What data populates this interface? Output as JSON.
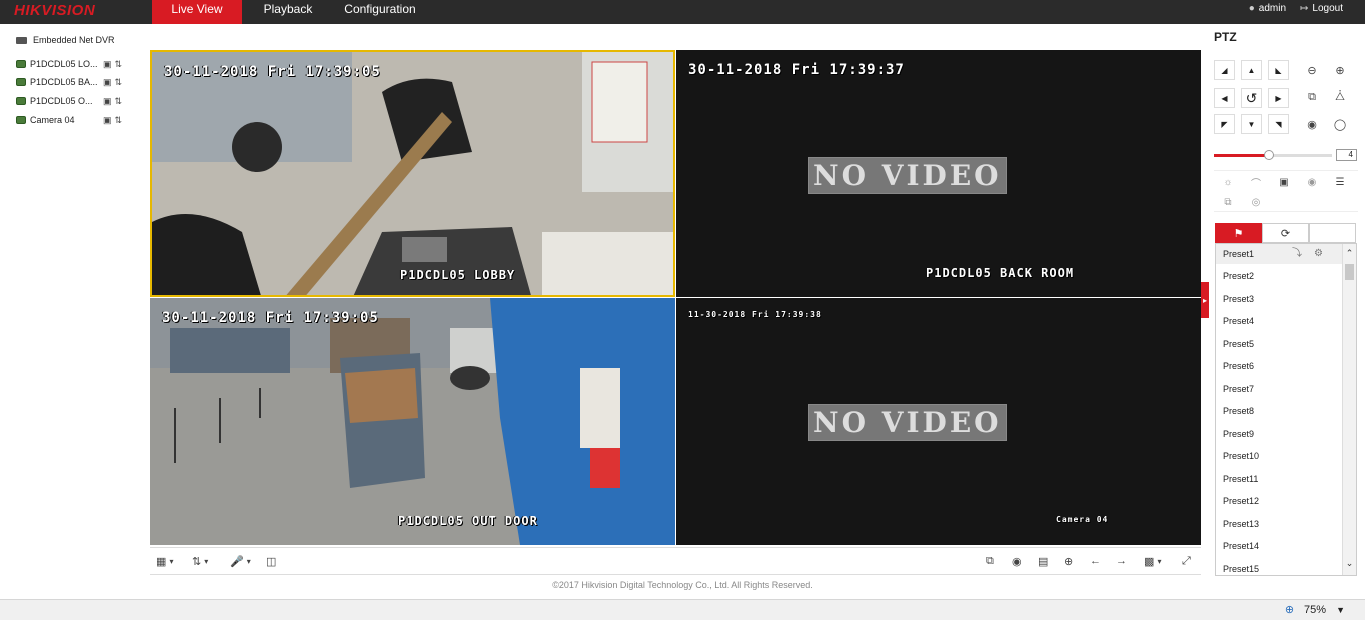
{
  "header": {
    "logo": "HIKVISION",
    "tabs": [
      {
        "label": "Live View",
        "active": true
      },
      {
        "label": "Playback"
      },
      {
        "label": "Configuration"
      }
    ],
    "user": "admin",
    "logout": "Logout"
  },
  "tree": {
    "root": "Embedded Net DVR",
    "cameras": [
      {
        "label": "P1DCDL05 LO..."
      },
      {
        "label": "P1DCDL05 BA..."
      },
      {
        "label": "P1DCDL05 O..."
      },
      {
        "label": "Camera 04"
      }
    ]
  },
  "video": {
    "panes": [
      {
        "timestamp": "30-11-2018 Fri 17:39:05",
        "name": "P1DCDL05 LOBBY",
        "selected": true
      },
      {
        "timestamp": "30-11-2018 Fri 17:39:37",
        "name": "P1DCDL05 BACK ROOM",
        "no_video": "NO VIDEO"
      },
      {
        "timestamp": "30-11-2018 Fri 17:39:05",
        "name": "P1DCDL05 OUT DOOR"
      },
      {
        "timestamp": "11-30-2018 Fri 17:39:38",
        "name": "Camera 04",
        "no_video": "NO VIDEO"
      }
    ]
  },
  "footer": {
    "copyright": "©2017 Hikvision Digital Technology Co., Ltd. All Rights Reserved."
  },
  "ptz": {
    "title": "PTZ",
    "speed": "4",
    "speed_fraction": 0.47,
    "presets": [
      "Preset1",
      "Preset2",
      "Preset3",
      "Preset4",
      "Preset5",
      "Preset6",
      "Preset7",
      "Preset8",
      "Preset9",
      "Preset10",
      "Preset11",
      "Preset12",
      "Preset13",
      "Preset14",
      "Preset15"
    ]
  },
  "status": {
    "zoom": "75%"
  },
  "colors": {
    "accent": "#d81b23",
    "selected_pane": "#e6b800"
  }
}
